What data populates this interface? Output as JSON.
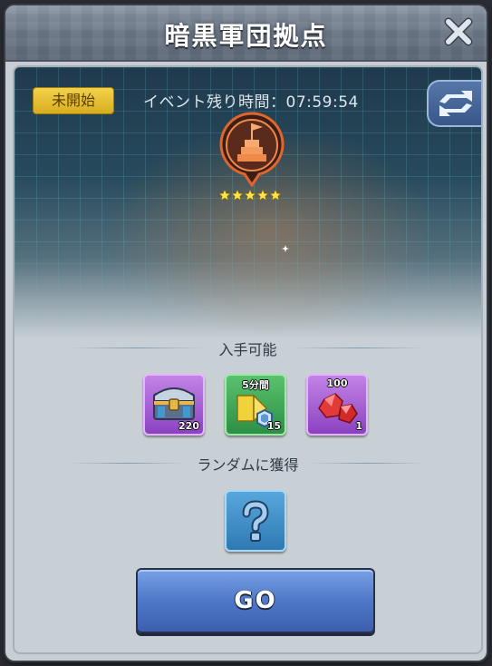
{
  "header": {
    "title": "暗黒軍団拠点"
  },
  "event": {
    "status_badge": "未開始",
    "timer_label": "イベント残り時間：07:59:54",
    "difficulty_stars": 5
  },
  "rewards": {
    "obtainable_label": "入手可能",
    "items": [
      {
        "icon": "treasure-chest-icon",
        "quantity": "220",
        "top_label": ""
      },
      {
        "icon": "speedup-ticket-icon",
        "quantity": "15",
        "top_label": "5分間"
      },
      {
        "icon": "red-gem-icon",
        "quantity": "1",
        "top_label": "100"
      }
    ],
    "random_label": "ランダムに獲得",
    "random_item": {
      "icon": "question-mark-icon"
    }
  },
  "actions": {
    "go_label": "GO"
  },
  "colors": {
    "accent": "#4e78c8",
    "badge": "#e6c234",
    "emblem": "#e0662c"
  }
}
